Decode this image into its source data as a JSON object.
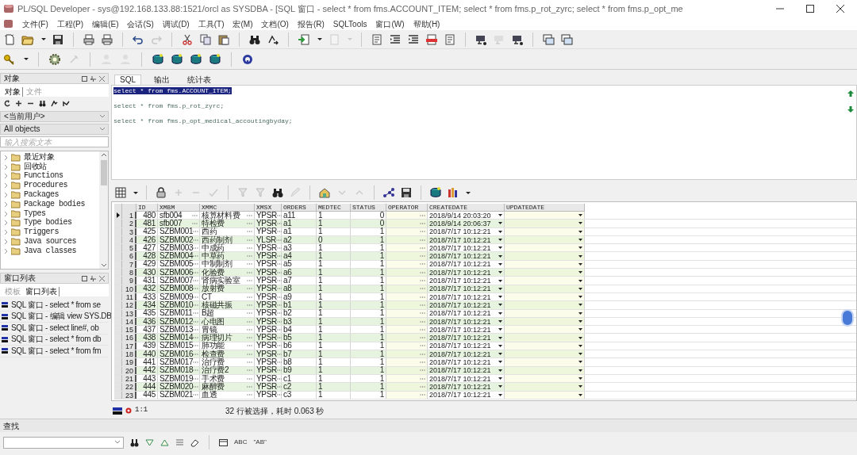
{
  "window": {
    "title": "PL/SQL Developer - sys@192.168.133.88:1521/orcl as SYSDBA - [SQL 窗口 - select * from fms.ACCOUNT_ITEM; select * from fms.p_rot_zyrc; select * from fms.p_opt_me"
  },
  "menu": [
    "文件(F)",
    "工程(P)",
    "编辑(E)",
    "会话(S)",
    "调试(D)",
    "工具(T)",
    "宏(M)",
    "文档(O)",
    "报告(R)",
    "SQLTools",
    "窗口(W)",
    "帮助(H)"
  ],
  "object_panel": {
    "title": "对象",
    "tabs": [
      {
        "label": "对象",
        "selected": true
      },
      {
        "label": "文件",
        "selected": false
      }
    ],
    "user_filter": "<当前用户>",
    "type_filter": "All objects",
    "search": {
      "placeholder": "输入搜索文本"
    },
    "tree": [
      {
        "label": "最近对象"
      },
      {
        "label": "回收站"
      },
      {
        "label": "Functions"
      },
      {
        "label": "Procedures"
      },
      {
        "label": "Packages"
      },
      {
        "label": "Package bodies"
      },
      {
        "label": "Types"
      },
      {
        "label": "Type bodies"
      },
      {
        "label": "Triggers"
      },
      {
        "label": "Java sources"
      },
      {
        "label": "Java classes"
      }
    ]
  },
  "window_list_panel": {
    "title": "窗口列表",
    "tabs": [
      {
        "label": "模板",
        "selected": false
      },
      {
        "label": "窗口列表",
        "selected": true
      }
    ],
    "items": [
      {
        "label": "SQL 窗口 - select * from se"
      },
      {
        "label": "SQL 窗口 - 编辑 view SYS.DB"
      },
      {
        "label": "SQL 窗口 - select line#, ob"
      },
      {
        "label": "SQL 窗口 - select * from db"
      },
      {
        "label": "SQL 窗口 - select * from fm"
      }
    ]
  },
  "editor": {
    "tabs": [
      {
        "label": "SQL",
        "selected": true
      },
      {
        "label": "输出",
        "selected": false
      },
      {
        "label": "统计表",
        "selected": false
      }
    ],
    "lines": [
      {
        "text": "select * from fms.ACCOUNT_ITEM;",
        "selected": true
      },
      {
        "text": "select * from fms.p_rot_zyrc;",
        "selected": false
      },
      {
        "text": "select * from fms.p_opt_medical_accoutingbyday;",
        "selected": false
      }
    ]
  },
  "result_grid": {
    "columns": [
      "ID",
      "XMBM",
      "XMMC",
      "XMSX",
      "ORDERS",
      "MEDTEC",
      "STATUS",
      "OPERATOR",
      "CREATEDATE",
      "UPDATEDATE"
    ],
    "rows": [
      {
        "selected": true,
        "row_number": "1",
        "id": "480",
        "xmbm": "sfb004",
        "xmmc": "核算材料费",
        "xmsx": "YPSR",
        "orders": "a11",
        "medtec": "1",
        "status": "0",
        "createdate": "2018/9/14 20:03:20"
      },
      {
        "selected": false,
        "row_number": "2",
        "id": "481",
        "xmbm": "sfb007",
        "xmmc": "特检费",
        "xmsx": "YPSR",
        "orders": "a1",
        "medtec": "1",
        "status": "0",
        "createdate": "2018/9/14 20:06:37"
      },
      {
        "selected": false,
        "row_number": "3",
        "id": "425",
        "xmbm": "SZBM001",
        "xmmc": "西药",
        "xmsx": "YPSR",
        "orders": "a1",
        "medtec": "1",
        "status": "1",
        "createdate": "2018/7/17 10:12:21"
      },
      {
        "selected": false,
        "row_number": "4",
        "id": "426",
        "xmbm": "SZBM002",
        "xmmc": "西药制剂",
        "xmsx": "YLSR",
        "orders": "a2",
        "medtec": "0",
        "status": "1",
        "createdate": "2018/7/17 10:12:21"
      },
      {
        "selected": false,
        "row_number": "5",
        "id": "427",
        "xmbm": "SZBM003",
        "xmmc": "中成药",
        "xmsx": "YPSR",
        "orders": "a3",
        "medtec": "1",
        "status": "1",
        "createdate": "2018/7/17 10:12:21"
      },
      {
        "selected": false,
        "row_number": "6",
        "id": "428",
        "xmbm": "SZBM004",
        "xmmc": "中草药",
        "xmsx": "YPSR",
        "orders": "a4",
        "medtec": "1",
        "status": "1",
        "createdate": "2018/7/17 10:12:21"
      },
      {
        "selected": false,
        "row_number": "7",
        "id": "429",
        "xmbm": "SZBM005",
        "xmmc": "中制制剂",
        "xmsx": "YPSR",
        "orders": "a5",
        "medtec": "1",
        "status": "1",
        "createdate": "2018/7/17 10:12:21"
      },
      {
        "selected": false,
        "row_number": "8",
        "id": "430",
        "xmbm": "SZBM006",
        "xmmc": "化验费",
        "xmsx": "YPSR",
        "orders": "a6",
        "medtec": "1",
        "status": "1",
        "createdate": "2018/7/17 10:12:21"
      },
      {
        "selected": false,
        "row_number": "9",
        "id": "431",
        "xmbm": "SZBM007",
        "xmmc": "肾病实验室",
        "xmsx": "YPSR",
        "orders": "a7",
        "medtec": "1",
        "status": "1",
        "createdate": "2018/7/17 10:12:21"
      },
      {
        "selected": false,
        "row_number": "10",
        "id": "432",
        "xmbm": "SZBM008",
        "xmmc": "放射费",
        "xmsx": "YPSR",
        "orders": "a8",
        "medtec": "1",
        "status": "1",
        "createdate": "2018/7/17 10:12:21"
      },
      {
        "selected": false,
        "row_number": "11",
        "id": "433",
        "xmbm": "SZBM009",
        "xmmc": "CT",
        "xmsx": "YPSR",
        "orders": "a9",
        "medtec": "1",
        "status": "1",
        "createdate": "2018/7/17 10:12:21"
      },
      {
        "selected": false,
        "row_number": "12",
        "id": "434",
        "xmbm": "SZBM010",
        "xmmc": "核磁共振",
        "xmsx": "YPSR",
        "orders": "b1",
        "medtec": "1",
        "status": "1",
        "createdate": "2018/7/17 10:12:21"
      },
      {
        "selected": false,
        "row_number": "13",
        "id": "435",
        "xmbm": "SZBM011",
        "xmmc": "B超",
        "xmsx": "YPSR",
        "orders": "b2",
        "medtec": "1",
        "status": "1",
        "createdate": "2018/7/17 10:12:21"
      },
      {
        "selected": false,
        "row_number": "14",
        "id": "436",
        "xmbm": "SZBM012",
        "xmmc": "心电图",
        "xmsx": "YPSR",
        "orders": "b3",
        "medtec": "1",
        "status": "1",
        "createdate": "2018/7/17 10:12:21"
      },
      {
        "selected": false,
        "row_number": "15",
        "id": "437",
        "xmbm": "SZBM013",
        "xmmc": "胃镜",
        "xmsx": "YPSR",
        "orders": "b4",
        "medtec": "1",
        "status": "1",
        "createdate": "2018/7/17 10:12:21"
      },
      {
        "selected": false,
        "row_number": "16",
        "id": "438",
        "xmbm": "SZBM014",
        "xmmc": "病理切片",
        "xmsx": "YPSR",
        "orders": "b5",
        "medtec": "1",
        "status": "1",
        "createdate": "2018/7/17 10:12:21"
      },
      {
        "selected": false,
        "row_number": "17",
        "id": "439",
        "xmbm": "SZBM015",
        "xmmc": "肺功能",
        "xmsx": "YPSR",
        "orders": "b6",
        "medtec": "1",
        "status": "1",
        "createdate": "2018/7/17 10:12:21"
      },
      {
        "selected": false,
        "row_number": "18",
        "id": "440",
        "xmbm": "SZBM016",
        "xmmc": "检查费",
        "xmsx": "YPSR",
        "orders": "b7",
        "medtec": "1",
        "status": "1",
        "createdate": "2018/7/17 10:12:21"
      },
      {
        "selected": false,
        "row_number": "19",
        "id": "441",
        "xmbm": "SZBM017",
        "xmmc": "治疗费",
        "xmsx": "YPSR",
        "orders": "b8",
        "medtec": "1",
        "status": "1",
        "createdate": "2018/7/17 10:12:21"
      },
      {
        "selected": false,
        "row_number": "20",
        "id": "442",
        "xmbm": "SZBM018",
        "xmmc": "治疗费2",
        "xmsx": "YPSR",
        "orders": "b9",
        "medtec": "1",
        "status": "1",
        "createdate": "2018/7/17 10:12:21"
      },
      {
        "selected": false,
        "row_number": "21",
        "id": "443",
        "xmbm": "SZBM019",
        "xmmc": "手术费",
        "xmsx": "YPSR",
        "orders": "c1",
        "medtec": "1",
        "status": "1",
        "createdate": "2018/7/17 10:12:21"
      },
      {
        "selected": false,
        "row_number": "22",
        "id": "444",
        "xmbm": "SZBM020",
        "xmmc": "麻醉费",
        "xmsx": "YPSR",
        "orders": "c2",
        "medtec": "1",
        "status": "1",
        "createdate": "2018/7/17 10:12:21"
      },
      {
        "selected": false,
        "row_number": "23",
        "id": "445",
        "xmbm": "SZBM021",
        "xmmc": "血透",
        "xmsx": "YPSR",
        "orders": "c3",
        "medtec": "1",
        "status": "1",
        "createdate": "2018/7/17 10:12:21"
      }
    ]
  },
  "status_bar": {
    "position": "1:1",
    "message": "32 行被选择，耗时 0.063 秒"
  },
  "find_panel": {
    "title": "查找",
    "buttons": [
      "ABC",
      "\"AB\""
    ]
  }
}
